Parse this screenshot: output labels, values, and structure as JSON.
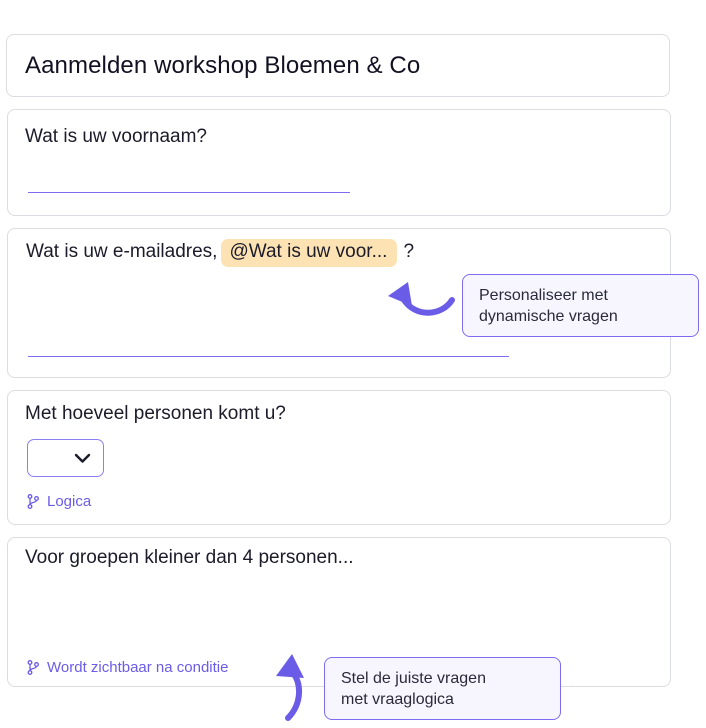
{
  "form_title": "Aanmelden workshop Bloemen & Co",
  "questions": {
    "q1": {
      "label": "Wat is uw voornaam?"
    },
    "q2": {
      "label_prefix": "Wat is uw e-mailadres,",
      "pill": "@Wat is uw voor...",
      "label_suffix": "?"
    },
    "q3": {
      "label": "Met hoeveel personen komt u?",
      "select_value": "",
      "logic_link": "Logica"
    },
    "q4": {
      "label": "Voor groepen kleiner dan 4 personen...",
      "condition_link": "Wordt zichtbaar na conditie"
    }
  },
  "tooltips": {
    "personalize": {
      "line1": "Personaliseer met",
      "line2": "dynamische vragen"
    },
    "logic": {
      "line1": "Stel de juiste vragen",
      "line2": "met vraaglogica"
    }
  },
  "icons": [
    "chevron-down-icon",
    "branch-icon",
    "curved-arrow-icon"
  ],
  "colors": {
    "accent": "#6b5ce7",
    "pill_bg": "#fde3b4",
    "tooltip_bg": "#f7f6fe",
    "border": "#dcdce3"
  }
}
